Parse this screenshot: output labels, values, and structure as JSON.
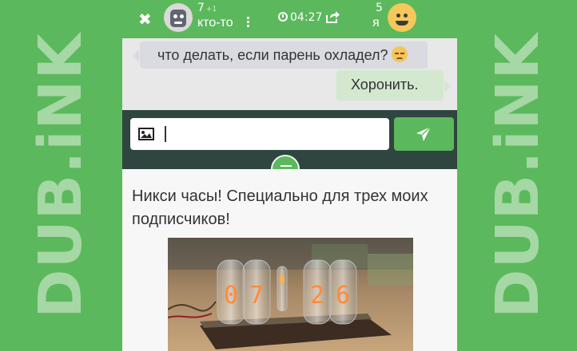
{
  "watermark": {
    "left_text": "DUB.iNK",
    "right_text": "DUB.iNK"
  },
  "header": {
    "left_user": {
      "count": "7",
      "delta": "+1",
      "name": "кто-то"
    },
    "timer": "04:27",
    "right_user": {
      "count": "5",
      "name": "я"
    }
  },
  "messages": [
    {
      "side": "incoming",
      "text": "что делать, если парень охладел?"
    },
    {
      "side": "outgoing",
      "text": "Хоронить."
    }
  ],
  "composer": {
    "value": "",
    "placeholder": ""
  },
  "post": {
    "text": "Никси часы! Специально для трех моих подписчиков!"
  },
  "photo": {
    "digits": [
      "0",
      "7",
      "2",
      "6"
    ]
  },
  "colors": {
    "accent": "#5cb85c",
    "bar_dark": "#2f4540",
    "bubble_in": "#d9dbe0",
    "bubble_out": "#d3e8cf"
  },
  "icons": [
    "close-icon",
    "clock-icon",
    "share-icon",
    "image-icon",
    "send-icon",
    "menu-icon",
    "sad-emoji-icon"
  ]
}
